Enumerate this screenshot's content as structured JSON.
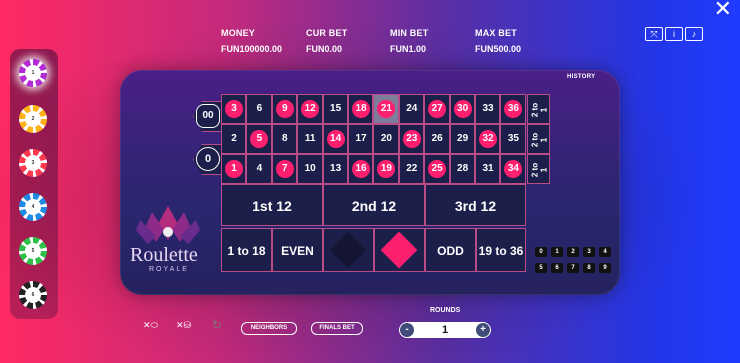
{
  "stats": [
    {
      "label": "MONEY",
      "value": "FUN100000.00"
    },
    {
      "label": "CUR BET",
      "value": "FUN0.00"
    },
    {
      "label": "MIN BET",
      "value": "FUN1.00"
    },
    {
      "label": "MAX BET",
      "value": "FUN500.00"
    }
  ],
  "history_label": "HISTORY",
  "zeros": [
    "00",
    "0"
  ],
  "board": {
    "top": [
      {
        "n": "3",
        "c": "red"
      },
      {
        "n": "6",
        "c": "black"
      },
      {
        "n": "9",
        "c": "red"
      },
      {
        "n": "12",
        "c": "red"
      },
      {
        "n": "15",
        "c": "black"
      },
      {
        "n": "18",
        "c": "red"
      },
      {
        "n": "21",
        "c": "red"
      },
      {
        "n": "24",
        "c": "black"
      },
      {
        "n": "27",
        "c": "red"
      },
      {
        "n": "30",
        "c": "red"
      },
      {
        "n": "33",
        "c": "black"
      },
      {
        "n": "36",
        "c": "red"
      }
    ],
    "middle": [
      {
        "n": "2",
        "c": "black"
      },
      {
        "n": "5",
        "c": "red"
      },
      {
        "n": "8",
        "c": "black"
      },
      {
        "n": "11",
        "c": "black"
      },
      {
        "n": "14",
        "c": "red"
      },
      {
        "n": "17",
        "c": "black"
      },
      {
        "n": "20",
        "c": "black"
      },
      {
        "n": "23",
        "c": "red"
      },
      {
        "n": "26",
        "c": "black"
      },
      {
        "n": "29",
        "c": "black"
      },
      {
        "n": "32",
        "c": "red"
      },
      {
        "n": "35",
        "c": "black"
      }
    ],
    "bottom": [
      {
        "n": "1",
        "c": "red"
      },
      {
        "n": "4",
        "c": "black"
      },
      {
        "n": "7",
        "c": "red"
      },
      {
        "n": "10",
        "c": "black"
      },
      {
        "n": "13",
        "c": "black"
      },
      {
        "n": "16",
        "c": "red"
      },
      {
        "n": "19",
        "c": "red"
      },
      {
        "n": "22",
        "c": "black"
      },
      {
        "n": "25",
        "c": "red"
      },
      {
        "n": "28",
        "c": "black"
      },
      {
        "n": "31",
        "c": "black"
      },
      {
        "n": "34",
        "c": "red"
      }
    ],
    "highlighted": "21"
  },
  "columns": [
    "2 to 1",
    "2 to 1",
    "2 to 1"
  ],
  "dozens": [
    "1st 12",
    "2nd 12",
    "3rd 12"
  ],
  "outside": [
    "1 to 18",
    "EVEN",
    "ODD",
    "19 to 36"
  ],
  "logo": {
    "brand": "Roulette",
    "sub": "ROYALE"
  },
  "mini_numbers": [
    "0",
    "1",
    "2",
    "3",
    "4",
    "5",
    "6",
    "7",
    "8",
    "9"
  ],
  "chips": [
    {
      "value": "1",
      "color": "#b42ad6"
    },
    {
      "value": "2",
      "color": "#ffb21a"
    },
    {
      "value": "3",
      "color": "#ff3a4e"
    },
    {
      "value": "4",
      "color": "#1f8ae6"
    },
    {
      "value": "5",
      "color": "#2fc04a"
    },
    {
      "value": "6",
      "color": "#222222"
    }
  ],
  "bottom": {
    "neighbors": "NEIGHBORS",
    "finals": "FINALS BET",
    "rounds_label": "ROUNDS",
    "rounds_value": "1",
    "minus": "-",
    "plus": "+"
  },
  "colors": {
    "red": "#ff1f6f",
    "black": "#1d1f4b",
    "border": "#b94b86"
  }
}
